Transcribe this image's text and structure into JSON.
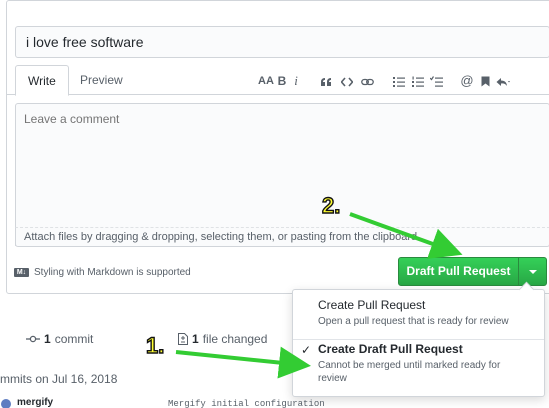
{
  "pr": {
    "title_value": "i love free software",
    "tabs": {
      "write": "Write",
      "preview": "Preview"
    },
    "toolbar": {
      "header": "AA",
      "bold": "B",
      "italic": "i"
    },
    "comment_placeholder": "Leave a comment",
    "attach_text": "Attach files by dragging & dropping, selecting them, or pasting from the clipboard.",
    "markdown_note": "Styling with Markdown is supported",
    "markdown_badge": "M↓"
  },
  "submit": {
    "draft_label": "Draft Pull Request",
    "accent": "#28a745"
  },
  "dropdown": {
    "items": [
      {
        "title": "Create Pull Request",
        "desc": "Open a pull request that is ready for review",
        "selected": false
      },
      {
        "title": "Create Draft Pull Request",
        "desc": "Cannot be merged until marked ready for review",
        "selected": true
      }
    ],
    "check": "✓"
  },
  "stats": {
    "commit_num": "1",
    "commit_label": "commit",
    "files_num": "1",
    "files_label": "file changed"
  },
  "history": {
    "date_line": "mmits on Jul 16, 2018",
    "user": "mergify",
    "message": "Mergify initial configuration"
  },
  "annotations": {
    "step1": "1.",
    "step2": "2.",
    "color": "#33cc33"
  }
}
